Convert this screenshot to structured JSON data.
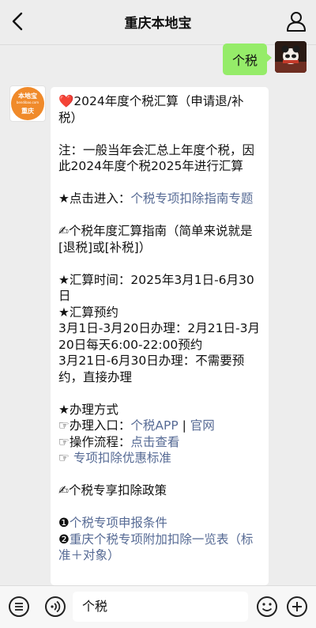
{
  "header": {
    "title": "重庆本地宝",
    "back_icon": "chevron-left-icon",
    "profile_icon": "person-icon"
  },
  "chat": {
    "user_message": "个税",
    "bot_logo": {
      "brand": "本地宝",
      "url": "bendibao.com",
      "city": "重庆"
    },
    "bot_lines": [
      {
        "id": "l1",
        "parts": [
          {
            "t": "❤️",
            "k": "heart"
          },
          {
            "t": "2024年度个税汇算（申请退/补税）"
          }
        ]
      },
      {
        "id": "g1",
        "gap": true
      },
      {
        "id": "l2",
        "parts": [
          {
            "t": "注：一般当年会汇总上年度个税，因此2024年度个税2025年进行汇算"
          }
        ]
      },
      {
        "id": "g2",
        "gap": true
      },
      {
        "id": "l3",
        "parts": [
          {
            "t": "★点击进入："
          },
          {
            "t": "个税专项扣除指南专题",
            "k": "link"
          }
        ]
      },
      {
        "id": "g3",
        "gap": true
      },
      {
        "id": "l4",
        "parts": [
          {
            "t": "✍个税年度汇算指南（简单来说就是[退税]或[补税]）"
          }
        ]
      },
      {
        "id": "g4",
        "gap": true
      },
      {
        "id": "l5",
        "parts": [
          {
            "t": "★汇算时间：2025年3月1日-6月30日"
          }
        ]
      },
      {
        "id": "l6",
        "parts": [
          {
            "t": "★汇算预约"
          }
        ]
      },
      {
        "id": "l7",
        "parts": [
          {
            "t": "3月1日-3月20日办理：2月21日-3月20日每天6:00-22:00预约"
          }
        ]
      },
      {
        "id": "l8",
        "parts": [
          {
            "t": "3月21日-6月30日办理：不需要预约，直接办理"
          }
        ]
      },
      {
        "id": "g5",
        "gap": true
      },
      {
        "id": "l9",
        "parts": [
          {
            "t": "★办理方式"
          }
        ]
      },
      {
        "id": "l10",
        "parts": [
          {
            "t": "☞办理入口："
          },
          {
            "t": "个税APP",
            "k": "link"
          },
          {
            "t": " | "
          },
          {
            "t": "官网",
            "k": "link"
          }
        ]
      },
      {
        "id": "l11",
        "parts": [
          {
            "t": "☞操作流程："
          },
          {
            "t": "点击查看",
            "k": "link"
          }
        ]
      },
      {
        "id": "l12",
        "parts": [
          {
            "t": "☞ "
          },
          {
            "t": "专项扣除优惠标准",
            "k": "link"
          }
        ]
      },
      {
        "id": "g6",
        "gap": true
      },
      {
        "id": "l13",
        "parts": [
          {
            "t": "✍个税专享扣除政策"
          }
        ]
      },
      {
        "id": "g7",
        "gap": true
      },
      {
        "id": "l14",
        "parts": [
          {
            "t": "❶"
          },
          {
            "t": "个税专项申报条件",
            "k": "link"
          }
        ]
      },
      {
        "id": "l15",
        "parts": [
          {
            "t": "❷"
          },
          {
            "t": "重庆个税专项附加扣除一览表（标准＋对象）",
            "k": "link"
          }
        ]
      }
    ]
  },
  "input_bar": {
    "voice_icon": "voice-icon",
    "input_value": "个税",
    "emoji_icon": "emoji-icon",
    "plus_icon": "plus-icon",
    "menu_icon": "menu-list-icon"
  },
  "colors": {
    "background": "#ededed",
    "user_bubble": "#95ec69",
    "link": "#576b95",
    "logo_orange": "#f08a2a"
  }
}
